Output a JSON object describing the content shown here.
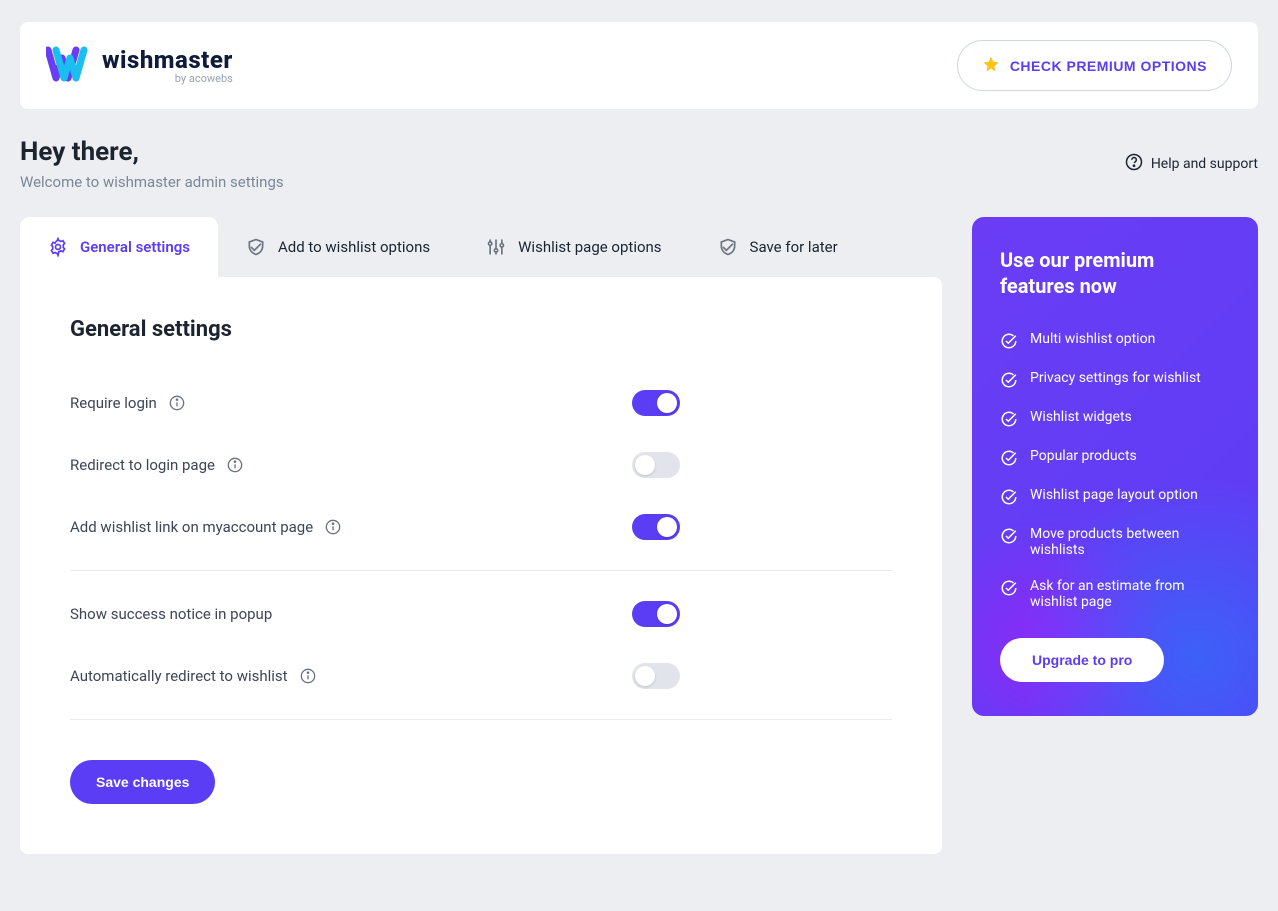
{
  "brand": {
    "name": "wishmaster",
    "subtitle": "by acowebs"
  },
  "header": {
    "premium_button": "CHECK PREMIUM OPTIONS"
  },
  "greeting": {
    "title": "Hey there,",
    "subtitle": "Welcome to wishmaster admin settings"
  },
  "help_label": "Help and support",
  "tabs": [
    {
      "label": "General settings",
      "active": true
    },
    {
      "label": "Add to wishlist options",
      "active": false
    },
    {
      "label": "Wishlist page options",
      "active": false
    },
    {
      "label": "Save for later",
      "active": false
    }
  ],
  "panel": {
    "heading": "General settings",
    "settings_group1": [
      {
        "label": "Require login",
        "on": true
      },
      {
        "label": "Redirect to login page",
        "on": false
      },
      {
        "label": "Add wishlist link on myaccount page",
        "on": true
      }
    ],
    "settings_group2": [
      {
        "label": "Show success notice in popup",
        "on": true
      },
      {
        "label": "Automatically redirect to wishlist",
        "on": false
      }
    ],
    "save_button": "Save changes"
  },
  "premium_panel": {
    "heading": "Use our premium features now",
    "features": [
      "Multi wishlist option",
      "Privacy settings for wishlist",
      "Wishlist widgets",
      "Popular products",
      "Wishlist page layout option",
      "Move products between wishlists",
      "Ask for an estimate from wishlist page"
    ],
    "upgrade_button": "Upgrade to pro"
  }
}
